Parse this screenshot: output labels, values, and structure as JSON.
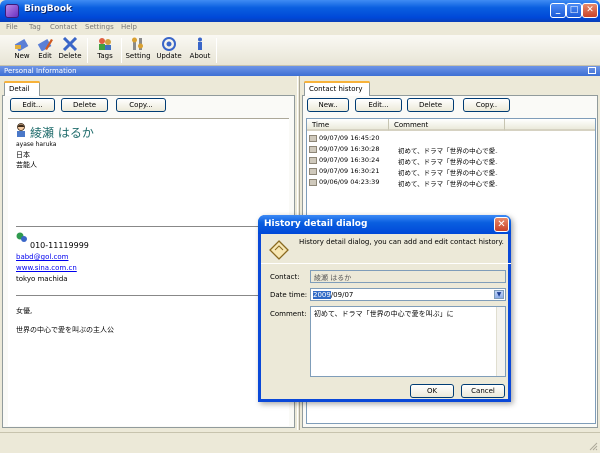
{
  "window": {
    "title": "BingBook"
  },
  "menu": [
    "File",
    "Tag",
    "Contact",
    "Settings",
    "Help"
  ],
  "toolbar": [
    {
      "label": "New",
      "icon": "new-contact-icon"
    },
    {
      "label": "Edit",
      "icon": "edit-icon"
    },
    {
      "label": "Delete",
      "icon": "delete-icon"
    },
    {
      "label": "Tags",
      "icon": "tags-icon"
    },
    {
      "label": "Setting",
      "icon": "setting-icon"
    },
    {
      "label": "Update",
      "icon": "update-icon"
    },
    {
      "label": "About",
      "icon": "about-icon"
    }
  ],
  "section_title": "Personal Information",
  "left": {
    "tab": "Detail",
    "buttons": {
      "edit": "Edit...",
      "delete": "Delete",
      "copy": "Copy..."
    },
    "name": "綾瀬 はるか",
    "romaji": "ayase haruka",
    "country": "日本",
    "occupation": "芸能人",
    "phone": "010-11119999",
    "email": "babd@gol.com",
    "website": "www.sina.com.cn",
    "address": "tokyo machida",
    "note_title": "女優,",
    "note": "世界の中心で愛を叫ぶの主人公"
  },
  "right": {
    "tab": "Contact history",
    "buttons": {
      "new": "New..",
      "edit": "Edit...",
      "delete": "Delete",
      "copy": "Copy.."
    },
    "columns": {
      "time": "Time",
      "comment": "Comment"
    },
    "rows": [
      {
        "time": "09/07/09 16:45:20",
        "comment": ""
      },
      {
        "time": "09/07/09 16:30:28",
        "comment": "初めて、ドラマ「世界の中心で愛..."
      },
      {
        "time": "09/07/09 16:30:24",
        "comment": "初めて、ドラマ「世界の中心で愛..."
      },
      {
        "time": "09/07/09 16:30:21",
        "comment": "初めて、ドラマ「世界の中心で愛..."
      },
      {
        "time": "09/06/09 04:23:39",
        "comment": "初めて、ドラマ「世界の中心で愛..."
      }
    ]
  },
  "dialog": {
    "title": "History detail dialog",
    "description": "History detail dialog, you can add and edit contact history.",
    "contact_label": "Contact:",
    "contact_value": "綾瀬 はるか",
    "date_label": "Date time:",
    "date_year": "2009",
    "date_rest": "/09/07",
    "comment_label": "Comment:",
    "comment_value": "初めて、ドラマ「世界の中心で愛を叫ぶ」に",
    "ok": "OK",
    "cancel": "Cancel"
  },
  "colors": {
    "title_bar": "#0a5fe0",
    "accent": "#316ac5",
    "link": "#0000ee",
    "name": "#1e6b6b"
  }
}
